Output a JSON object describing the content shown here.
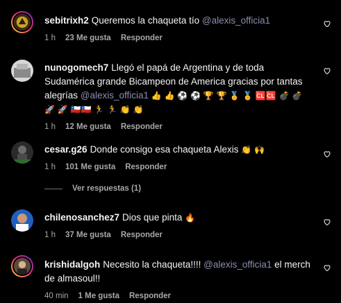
{
  "comments": [
    {
      "username": "sebitrixh2",
      "text": "Queremos la chaqueta tío",
      "mention": "@alexis_officia1",
      "text_after": "",
      "time": "1 h",
      "likes": "23 Me gusta",
      "reply": "Responder"
    },
    {
      "username": "nunogomech7",
      "text": "Llegó el papá de Argentina y de toda Sudamérica grande Bicampeon de America gracias por tantas alegrías",
      "mention": "@alexis_officia1",
      "text_after": "👍 👍 ⚽ ⚽ 🏆 🏆 🏅 🏅 🆑🆑 💣 💣 🚀 🚀 🇨🇱🇨🇱 🏃 🏃 👏 👏",
      "time": "1 h",
      "likes": "12 Me gusta",
      "reply": "Responder"
    },
    {
      "username": "cesar.g26",
      "text": "Donde consigo esa chaqueta Alexis",
      "mention": "",
      "text_after": "👏 🙌",
      "time": "1 h",
      "likes": "101 Me gusta",
      "reply": "Responder",
      "view_replies": "Ver respuestas (1)"
    },
    {
      "username": "chilenosanchez7",
      "text": "Dios que pinta",
      "mention": "",
      "text_after": "🔥",
      "time": "1 h",
      "likes": "37 Me gusta",
      "reply": "Responder"
    },
    {
      "username": "krishidalgoh",
      "text": "Necesito la chaqueta!!!!",
      "mention": "@alexis_officia1",
      "text_after": "el merch de almasoul!!",
      "time": "40 min",
      "likes": "1 Me gusta",
      "reply": "Responder"
    }
  ],
  "colors": {
    "background": "#000000",
    "text": "#f5f5f5",
    "meta": "#a8a8a8",
    "mention": "#8a8fb0"
  },
  "icons": {
    "like": "heart-outline-icon"
  }
}
